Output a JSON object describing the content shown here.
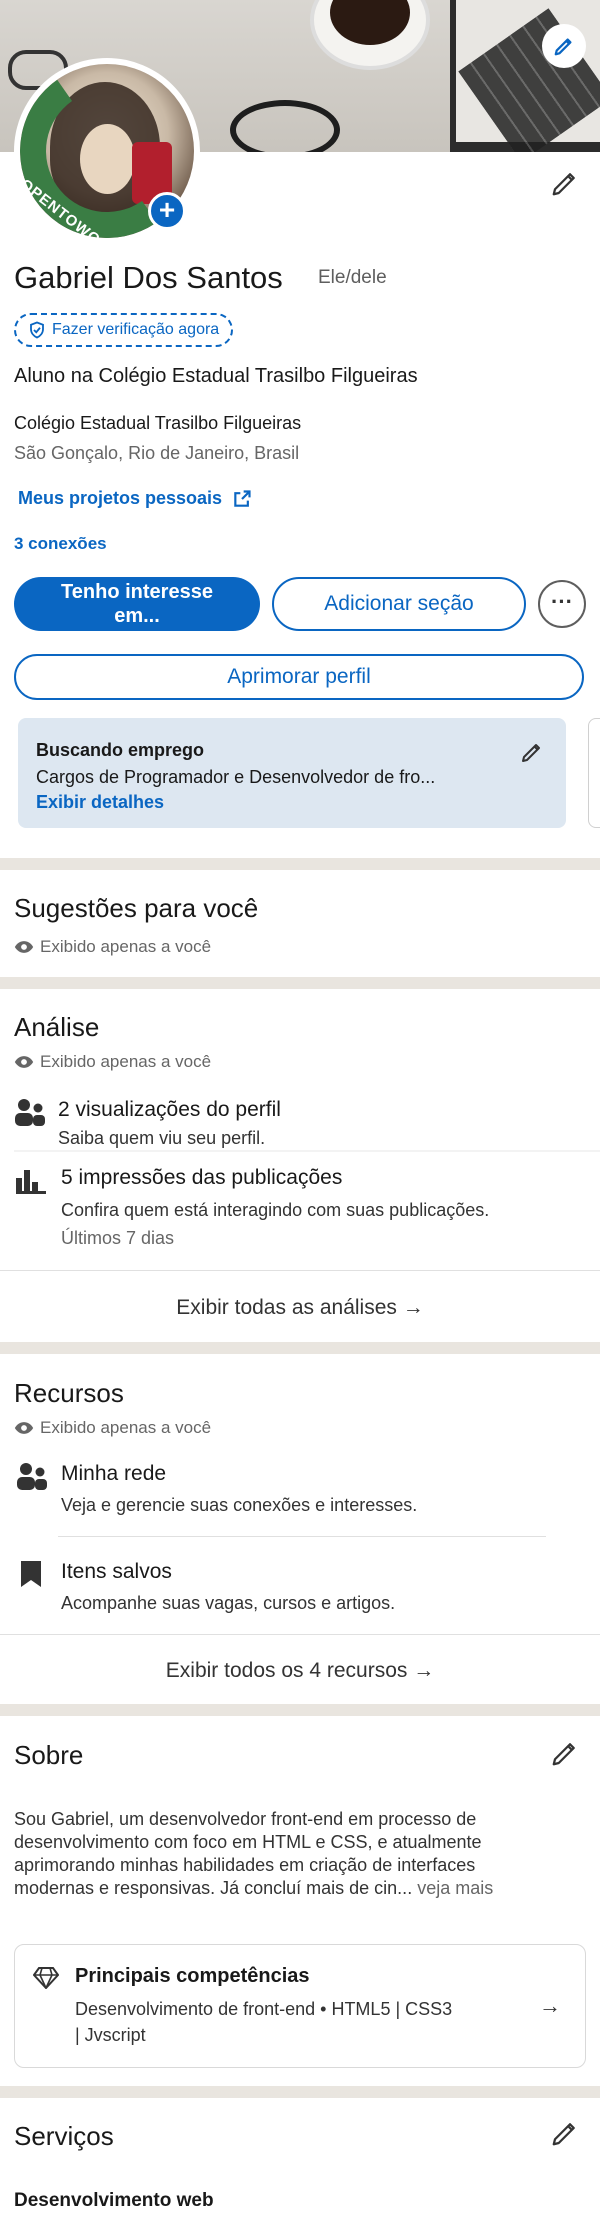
{
  "profile": {
    "name": "Gabriel Dos Santos",
    "pronoun": "Ele/dele",
    "verify_label": "Fazer verificação agora",
    "headline": "Aluno na Colégio Estadual Trasilbo Filgueiras",
    "school": "Colégio Estadual Trasilbo Filgueiras",
    "location": "São Gonçalo, Rio de Janeiro, Brasil",
    "projects_link": "Meus projetos pessoais",
    "connections": "3 conexões",
    "open_to_work_badge": "#OPENTOWORK"
  },
  "actions": {
    "primary_line1": "Tenho interesse",
    "primary_line2": "em...",
    "add_section": "Adicionar seção",
    "more": "···",
    "improve_profile": "Aprimorar perfil"
  },
  "job_card": {
    "title": "Buscando emprego",
    "description": "Cargos de Programador e Desenvolvedor de fro...",
    "link": "Exibir detalhes"
  },
  "suggestions": {
    "title": "Sugestões para você",
    "visibility": "Exibido apenas a você"
  },
  "analytics": {
    "title": "Análise",
    "visibility": "Exibido apenas a você",
    "items": [
      {
        "title": "2 visualizações do perfil",
        "subtitle": "Saiba quem viu seu perfil."
      },
      {
        "title": "5 impressões das publicações",
        "subtitle": "Confira quem está interagindo com suas publicações.",
        "meta": "Últimos 7 dias"
      }
    ],
    "footer": "Exibir todas as análises →"
  },
  "resources": {
    "title": "Recursos",
    "visibility": "Exibido apenas a você",
    "items": [
      {
        "title": "Minha rede",
        "subtitle": "Veja e gerencie suas conexões e interesses."
      },
      {
        "title": "Itens salvos",
        "subtitle": "Acompanhe suas vagas, cursos e artigos."
      }
    ],
    "footer": "Exibir todos os 4 recursos →"
  },
  "about": {
    "title": "Sobre",
    "text_lines": [
      "Sou Gabriel, um desenvolvedor front-end em processo de",
      "desenvolvimento com foco em HTML e CSS, e atualmente",
      "aprimorando minhas habilidades em criação de interfaces",
      "modernas e responsivas.  Já concluí mais de cin..."
    ],
    "see_more": "veja mais",
    "skills_title": "Principais competências",
    "skills_line1": "Desenvolvimento de front-end • HTML5 | CSS3",
    "skills_line2": "| Jvscript"
  },
  "services": {
    "title": "Serviços",
    "first_item": "Desenvolvimento web"
  },
  "colors": {
    "accent": "#0a66c2",
    "open_to_work": "#3a7d44",
    "section_separator": "#e9e5df",
    "job_card_bg": "#dde7f1"
  }
}
